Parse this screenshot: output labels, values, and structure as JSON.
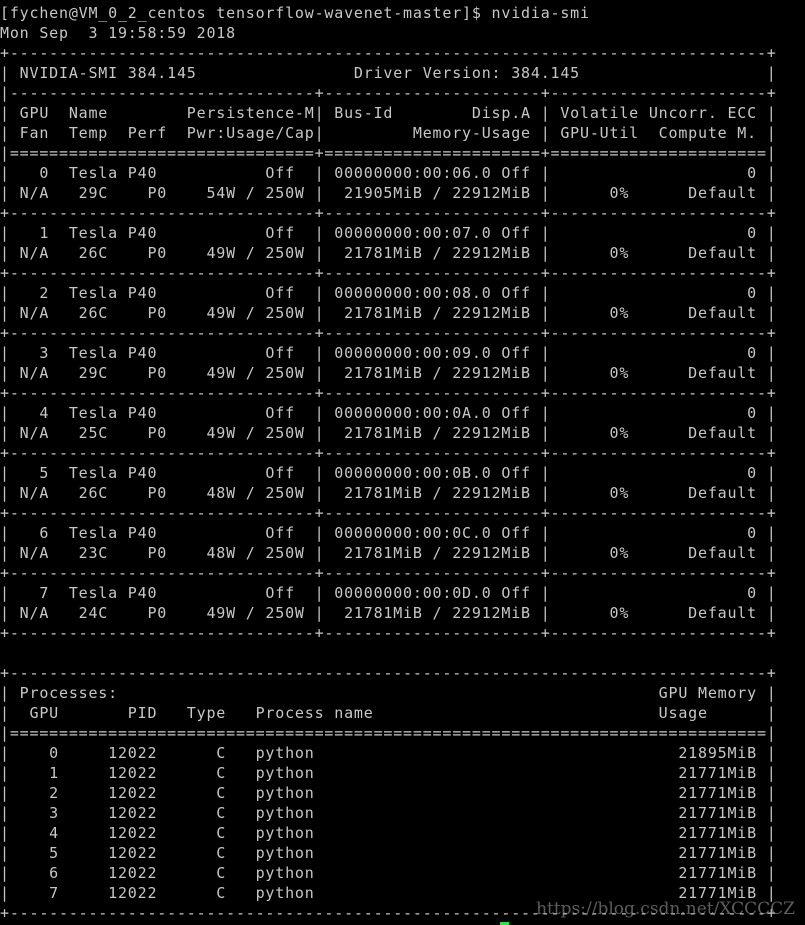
{
  "terminal": {
    "lines": [
      "[fychen@VM_0_2_centos tensorflow-wavenet-master]$ nvidia-smi",
      "Mon Sep  3 19:58:59 2018",
      "+-----------------------------------------------------------------------------+",
      "| NVIDIA-SMI 384.145                Driver Version: 384.145                   |",
      "|-------------------------------+----------------------+----------------------+",
      "| GPU  Name        Persistence-M| Bus-Id        Disp.A | Volatile Uncorr. ECC |",
      "| Fan  Temp  Perf  Pwr:Usage/Cap|         Memory-Usage | GPU-Util  Compute M. |",
      "|===============================+======================+======================|",
      "|   0  Tesla P40           Off  | 00000000:00:06.0 Off |                    0 |",
      "| N/A   29C    P0    54W / 250W |  21905MiB / 22912MiB |      0%      Default |",
      "+-------------------------------+----------------------+----------------------+",
      "|   1  Tesla P40           Off  | 00000000:00:07.0 Off |                    0 |",
      "| N/A   26C    P0    49W / 250W |  21781MiB / 22912MiB |      0%      Default |",
      "+-------------------------------+----------------------+----------------------+",
      "|   2  Tesla P40           Off  | 00000000:00:08.0 Off |                    0 |",
      "| N/A   26C    P0    49W / 250W |  21781MiB / 22912MiB |      0%      Default |",
      "+-------------------------------+----------------------+----------------------+",
      "|   3  Tesla P40           Off  | 00000000:00:09.0 Off |                    0 |",
      "| N/A   29C    P0    49W / 250W |  21781MiB / 22912MiB |      0%      Default |",
      "+-------------------------------+----------------------+----------------------+",
      "|   4  Tesla P40           Off  | 00000000:00:0A.0 Off |                    0 |",
      "| N/A   25C    P0    49W / 250W |  21781MiB / 22912MiB |      0%      Default |",
      "+-------------------------------+----------------------+----------------------+",
      "|   5  Tesla P40           Off  | 00000000:00:0B.0 Off |                    0 |",
      "| N/A   26C    P0    48W / 250W |  21781MiB / 22912MiB |      0%      Default |",
      "+-------------------------------+----------------------+----------------------+",
      "|   6  Tesla P40           Off  | 00000000:00:0C.0 Off |                    0 |",
      "| N/A   23C    P0    48W / 250W |  21781MiB / 22912MiB |      0%      Default |",
      "+-------------------------------+----------------------+----------------------+",
      "|   7  Tesla P40           Off  | 00000000:00:0D.0 Off |                    0 |",
      "| N/A   24C    P0    49W / 250W |  21781MiB / 22912MiB |      0%      Default |",
      "+-------------------------------+----------------------+----------------------+",
      "",
      "+-----------------------------------------------------------------------------+",
      "| Processes:                                                       GPU Memory |",
      "|  GPU       PID   Type   Process name                             Usage      |",
      "|=============================================================================|",
      "|    0     12022      C   python                                     21895MiB |",
      "|    1     12022      C   python                                     21771MiB |",
      "|    2     12022      C   python                                     21771MiB |",
      "|    3     12022      C   python                                     21771MiB |",
      "|    4     12022      C   python                                     21771MiB |",
      "|    5     12022      C   python                                     21771MiB |",
      "|    6     12022      C   python                                     21771MiB |",
      "|    7     12022      C   python                                     21771MiB |",
      "+-----------------------------------------------------------------------------+"
    ]
  },
  "watermark": "https://blog.csdn.net/XCCCCZ",
  "colors": {
    "background": "#000000",
    "text": "#c7c7c7",
    "cursor": "#2ee04a"
  }
}
